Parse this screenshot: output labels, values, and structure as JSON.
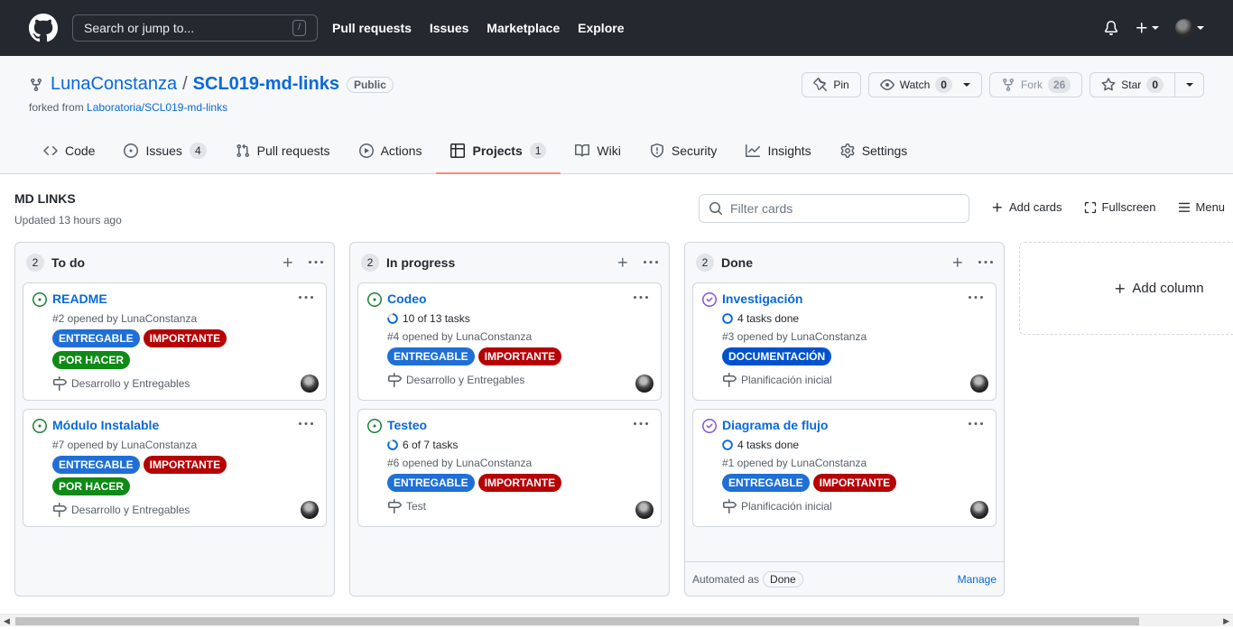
{
  "header": {
    "search_placeholder": "Search or jump to...",
    "search_shortcut": "/",
    "nav": [
      "Pull requests",
      "Issues",
      "Marketplace",
      "Explore"
    ]
  },
  "repo": {
    "owner": "LunaConstanza",
    "separator": "/",
    "name": "SCL019-md-links",
    "visibility": "Public",
    "forked_prefix": "forked from ",
    "forked_from": "Laboratoria/SCL019-md-links",
    "actions": {
      "pin": "Pin",
      "watch": "Watch",
      "watch_count": "0",
      "fork": "Fork",
      "fork_count": "26",
      "star": "Star",
      "star_count": "0"
    },
    "tabs": [
      {
        "label": "Code",
        "count": ""
      },
      {
        "label": "Issues",
        "count": "4"
      },
      {
        "label": "Pull requests",
        "count": ""
      },
      {
        "label": "Actions",
        "count": ""
      },
      {
        "label": "Projects",
        "count": "1"
      },
      {
        "label": "Wiki",
        "count": ""
      },
      {
        "label": "Security",
        "count": ""
      },
      {
        "label": "Insights",
        "count": ""
      },
      {
        "label": "Settings",
        "count": ""
      }
    ]
  },
  "project": {
    "title": "MD LINKS",
    "updated": "Updated 13 hours ago",
    "filter_placeholder": "Filter cards",
    "tools": {
      "add_cards": "Add cards",
      "fullscreen": "Fullscreen",
      "menu": "Menu"
    },
    "add_column": "Add column",
    "columns": [
      {
        "name": "To do",
        "count": "2",
        "cards": [
          {
            "title": "README",
            "tasks": "",
            "meta": "#2 opened by LunaConstanza",
            "labels": [
              "ENTREGABLE",
              "IMPORTANTE",
              "POR HACER"
            ],
            "milestone": "Desarrollo y Entregables"
          },
          {
            "title": "Módulo Instalable",
            "tasks": "",
            "meta": "#7 opened by LunaConstanza",
            "labels": [
              "ENTREGABLE",
              "IMPORTANTE",
              "POR HACER"
            ],
            "milestone": "Desarrollo y Entregables"
          }
        ]
      },
      {
        "name": "In progress",
        "count": "2",
        "cards": [
          {
            "title": "Codeo",
            "tasks": "10 of 13 tasks",
            "meta": "#4 opened by LunaConstanza",
            "labels": [
              "ENTREGABLE",
              "IMPORTANTE"
            ],
            "milestone": "Desarrollo y Entregables"
          },
          {
            "title": "Testeo",
            "tasks": "6 of 7 tasks",
            "meta": "#6 opened by LunaConstanza",
            "labels": [
              "ENTREGABLE",
              "IMPORTANTE"
            ],
            "milestone": "Test"
          }
        ]
      },
      {
        "name": "Done",
        "count": "2",
        "automated_prefix": "Automated as",
        "automated_value": "Done",
        "manage": "Manage",
        "cards": [
          {
            "title": "Investigación",
            "tasks": "4 tasks done",
            "meta": "#3 opened by LunaConstanza",
            "labels": [
              "DOCUMENTACIÓN"
            ],
            "milestone": "Planificación inicial"
          },
          {
            "title": "Diagrama de flujo",
            "tasks": "4 tasks done",
            "meta": "#1 opened by LunaConstanza",
            "labels": [
              "ENTREGABLE",
              "IMPORTANTE"
            ],
            "milestone": "Planificación inicial"
          }
        ]
      }
    ]
  },
  "label_colors": {
    "ENTREGABLE": "#1f6fd6",
    "IMPORTANTE": "#b60205",
    "POR HACER": "#0e8a16",
    "DOCUMENTACIÓN": "#0052cc"
  },
  "colors": {
    "header_bg": "#24292f",
    "link": "#0969da",
    "open_green": "#1a7f37",
    "closed_purple": "#8250df",
    "tab_underline": "#fd8c73"
  }
}
